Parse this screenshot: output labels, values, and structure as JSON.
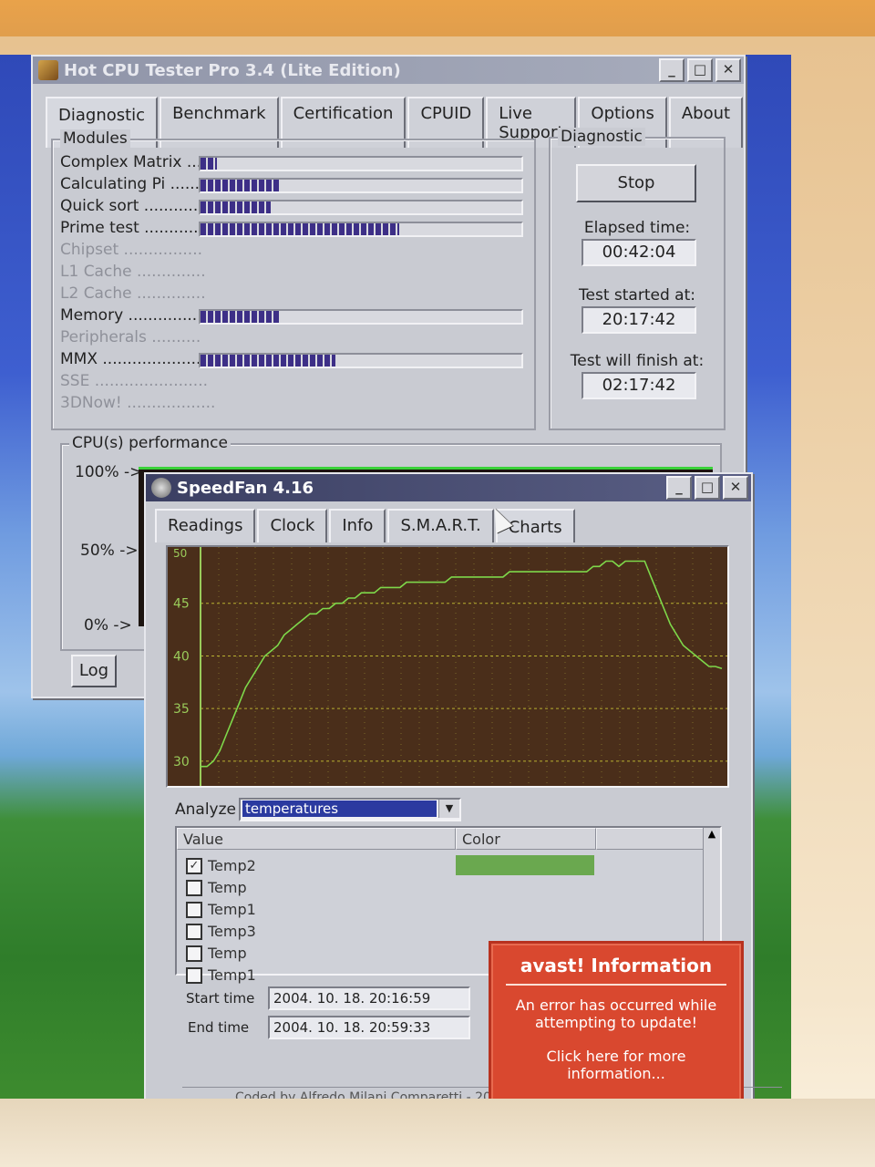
{
  "hot_cpu": {
    "title": "Hot CPU Tester Pro 3.4 (Lite Edition)",
    "tabs": [
      "Diagnostic",
      "Benchmark",
      "Certification",
      "CPUID",
      "Live Support",
      "Options",
      "About"
    ],
    "modules_label": "Modules",
    "modules": [
      {
        "label": "Complex Matrix ....",
        "progress": 0.05,
        "enabled": true
      },
      {
        "label": "Calculating Pi ......",
        "progress": 0.25,
        "enabled": true
      },
      {
        "label": "Quick sort ...........",
        "progress": 0.22,
        "enabled": true
      },
      {
        "label": "Prime test ...........",
        "progress": 0.62,
        "enabled": true
      },
      {
        "label": "Chipset ................",
        "progress": null,
        "enabled": false
      },
      {
        "label": "L1 Cache ..............",
        "progress": null,
        "enabled": false
      },
      {
        "label": "L2 Cache ..............",
        "progress": null,
        "enabled": false
      },
      {
        "label": "Memory ................",
        "progress": 0.25,
        "enabled": true
      },
      {
        "label": "Peripherals ..........",
        "progress": null,
        "enabled": false
      },
      {
        "label": "MMX .....................",
        "progress": 0.42,
        "enabled": true
      },
      {
        "label": "SSE .......................",
        "progress": null,
        "enabled": false
      },
      {
        "label": "3DNow! ..................",
        "progress": null,
        "enabled": false
      }
    ],
    "diagnostic_label": "Diagnostic",
    "stop_label": "Stop",
    "elapsed_label": "Elapsed time:",
    "elapsed_value": "00:42:04",
    "started_label": "Test started at:",
    "started_value": "20:17:42",
    "finish_label": "Test will finish at:",
    "finish_value": "02:17:42",
    "perf_label": "CPU(s) performance",
    "perf_ticks": [
      "100% ->",
      "50% ->",
      "0% ->"
    ],
    "log_label": "Log"
  },
  "speedfan": {
    "title": "SpeedFan 4.16",
    "tabs": [
      "Readings",
      "Clock",
      "Info",
      "S.M.A.R.T.",
      "Charts"
    ],
    "analyze_label": "Analyze",
    "analyze_value": "temperatures",
    "list_headers": [
      "Value",
      "Color"
    ],
    "list_items": [
      {
        "label": "Temp2",
        "checked": true
      },
      {
        "label": "Temp",
        "checked": false
      },
      {
        "label": "Temp1",
        "checked": false
      },
      {
        "label": "Temp3",
        "checked": false
      },
      {
        "label": "Temp",
        "checked": false
      },
      {
        "label": "Temp1",
        "checked": false
      }
    ],
    "temp2_color": "#6aa84f",
    "start_label": "Start time",
    "start_value": "2004. 10. 18. 20:16:59",
    "end_label": "End time",
    "end_value": "2004. 10. 18. 20:59:33",
    "footer": "Coded by Alfredo Milani Comparetti - 20"
  },
  "avast": {
    "title": "avast! Information",
    "message": "An error has occurred while attempting to update!",
    "link": "Click here for more information..."
  },
  "chart_data": {
    "type": "line",
    "ylim": [
      28,
      50
    ],
    "yticks": [
      30,
      35,
      40,
      45
    ],
    "y_top_label": "50",
    "series": [
      {
        "values": [
          29.5,
          29.5,
          30,
          31,
          32.5,
          34,
          35.5,
          37,
          38,
          39,
          40,
          40.5,
          41,
          42,
          42.5,
          43,
          43.5,
          44,
          44,
          44.5,
          44.5,
          45,
          45,
          45.5,
          45.5,
          46,
          46,
          46,
          46.5,
          46.5,
          46.5,
          46.5,
          47,
          47,
          47,
          47,
          47,
          47,
          47,
          47.5,
          47.5,
          47.5,
          47.5,
          47.5,
          47.5,
          47.5,
          47.5,
          47.5,
          48,
          48,
          48,
          48,
          48,
          48,
          48,
          48,
          48,
          48,
          48,
          48,
          48,
          48.5,
          48.5,
          49,
          49,
          48.5,
          49,
          49,
          49,
          49,
          47.5,
          46,
          44.5,
          43,
          42,
          41,
          40.5,
          40,
          39.5,
          39,
          39,
          38.8
        ]
      }
    ]
  }
}
